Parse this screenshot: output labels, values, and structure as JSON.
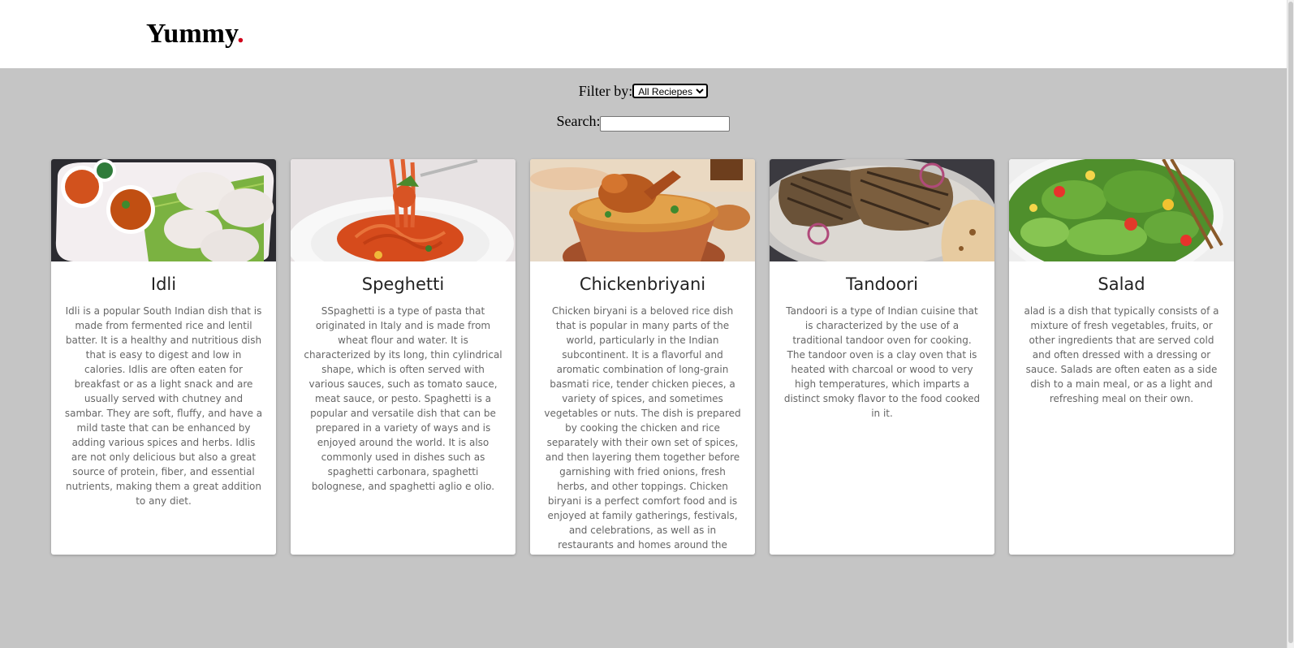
{
  "header": {
    "logo_text": "Yummy",
    "logo_dot": ".",
    "accent_color": "#d0021b"
  },
  "filter": {
    "label": "Filter by:",
    "selected": "All Reciepes"
  },
  "search": {
    "label": "Search:",
    "value": ""
  },
  "recipes": [
    {
      "title": "Idli",
      "image": "idli-photo",
      "description": "Idli is a popular South Indian dish that is made from fermented rice and lentil batter. It is a healthy and nutritious dish that is easy to digest and low in calories. Idlis are often eaten for breakfast or as a light snack and are usually served with chutney and sambar. They are soft, fluffy, and have a mild taste that can be enhanced by adding various spices and herbs. Idlis are not only delicious but also a great source of protein, fiber, and essential nutrients, making them a great addition to any diet."
    },
    {
      "title": "Speghetti",
      "image": "spaghetti-photo",
      "description": "SSpaghetti is a type of pasta that originated in Italy and is made from wheat flour and water. It is characterized by its long, thin cylindrical shape, which is often served with various sauces, such as tomato sauce, meat sauce, or pesto. Spaghetti is a popular and versatile dish that can be prepared in a variety of ways and is enjoyed around the world. It is also commonly used in dishes such as spaghetti carbonara, spaghetti bolognese, and spaghetti aglio e olio."
    },
    {
      "title": "Chickenbriyani",
      "image": "biryani-photo",
      "description": "Chicken biryani is a beloved rice dish that is popular in many parts of the world, particularly in the Indian subcontinent. It is a flavorful and aromatic combination of long-grain basmati rice, tender chicken pieces, a variety of spices, and sometimes vegetables or nuts. The dish is prepared by cooking the chicken and rice separately with their own set of spices, and then layering them together before garnishing with fried onions, fresh herbs, and other toppings. Chicken biryani is a perfect comfort food and is enjoyed at family gatherings, festivals, and celebrations, as well as in restaurants and homes around the world."
    },
    {
      "title": "Tandoori",
      "image": "tandoori-photo",
      "description": "Tandoori is a type of Indian cuisine that is characterized by the use of a traditional tandoor oven for cooking. The tandoor oven is a clay oven that is heated with charcoal or wood to very high temperatures, which imparts a distinct smoky flavor to the food cooked in it."
    },
    {
      "title": "Salad",
      "image": "salad-photo",
      "description": "alad is a dish that typically consists of a mixture of fresh vegetables, fruits, or other ingredients that are served cold and often dressed with a dressing or sauce. Salads are often eaten as a side dish to a main meal, or as a light and refreshing meal on their own."
    }
  ]
}
